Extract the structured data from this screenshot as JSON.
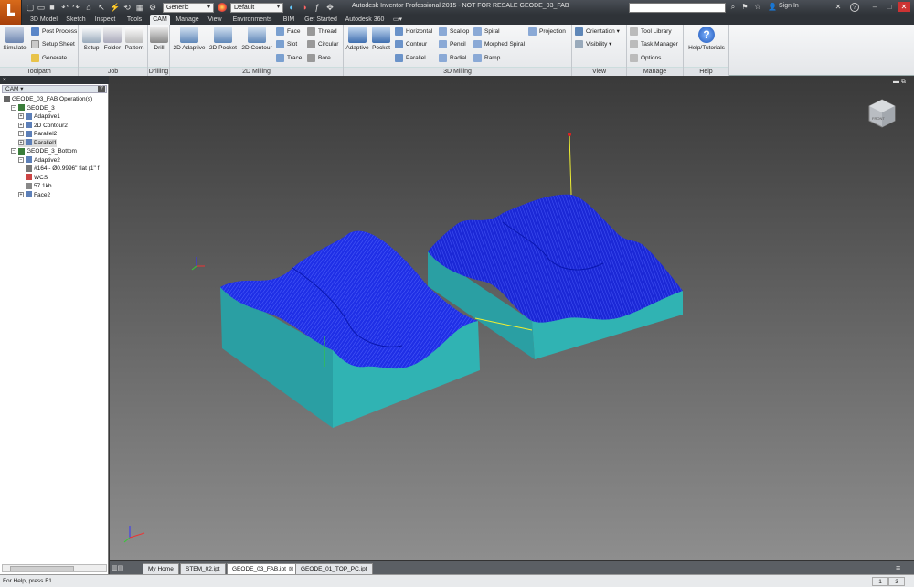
{
  "titlebar": {
    "app_title": "Autodesk Inventor Professional 2015 - NOT FOR RESALE   GEODE_03_FAB",
    "material_combo": "Generic",
    "appearance_combo": "Default",
    "search_placeholder": "",
    "sign_in": "Sign In",
    "help_label": "?"
  },
  "tabs": [
    "3D Model",
    "Sketch",
    "Inspect",
    "Tools",
    "CAM",
    "Manage",
    "View",
    "Environments",
    "BIM",
    "Get Started",
    "Autodesk 360"
  ],
  "active_tab": "CAM",
  "ribbon": {
    "toolpath": {
      "label": "Toolpath",
      "simulate": "Simulate",
      "post_process": "Post Process",
      "setup_sheet": "Setup Sheet",
      "generate": "Generate"
    },
    "job": {
      "label": "Job",
      "setup": "Setup",
      "folder": "Folder",
      "pattern": "Pattern"
    },
    "drilling": {
      "label": "Drilling",
      "drill": "Drill"
    },
    "milling2d": {
      "label": "2D Milling",
      "adaptive": "2D Adaptive",
      "pocket": "2D Pocket",
      "contour": "2D Contour",
      "face": "Face",
      "slot": "Slot",
      "trace": "Trace",
      "thread": "Thread",
      "circular": "Circular",
      "bore": "Bore"
    },
    "milling3d": {
      "label": "3D Milling",
      "adaptive": "Adaptive",
      "pocket": "Pocket",
      "horizontal": "Horizontal",
      "contour": "Contour",
      "parallel": "Parallel",
      "scallop": "Scallop",
      "pencil": "Pencil",
      "radial": "Radial",
      "spiral": "Spiral",
      "morphed_spiral": "Morphed Spiral",
      "ramp": "Ramp",
      "projection": "Projection"
    },
    "view": {
      "label": "View",
      "orientation": "Orientation",
      "visibility": "Visibility"
    },
    "manage": {
      "label": "Manage",
      "tool_library": "Tool Library",
      "task_manager": "Task Manager",
      "options": "Options"
    },
    "help": {
      "label": "Help",
      "help_tutorials": "Help/Tutorials"
    }
  },
  "browser": {
    "cam_label": "CAM ▾",
    "help_icon": "?",
    "tree": [
      {
        "label": "GEODE_03_FAB Operation(s)",
        "indent": 0,
        "expander": "",
        "icon": "gear",
        "selected": false
      },
      {
        "label": "GEODE_3",
        "indent": 1,
        "expander": "−",
        "icon": "setup",
        "selected": false
      },
      {
        "label": "Adaptive1",
        "indent": 2,
        "expander": "+",
        "icon": "op",
        "selected": false
      },
      {
        "label": "2D Contour2",
        "indent": 2,
        "expander": "+",
        "icon": "op",
        "selected": false
      },
      {
        "label": "Parallel2",
        "indent": 2,
        "expander": "+",
        "icon": "op",
        "selected": false
      },
      {
        "label": "Parallel1",
        "indent": 2,
        "expander": "+",
        "icon": "op",
        "selected": true
      },
      {
        "label": "GEODE_3_Bottom",
        "indent": 1,
        "expander": "−",
        "icon": "setup",
        "selected": false
      },
      {
        "label": "Adaptive2",
        "indent": 2,
        "expander": "−",
        "icon": "op",
        "selected": false
      },
      {
        "label": "#164 - Ø0.9996\" flat (1\" f",
        "indent": 3,
        "expander": "",
        "icon": "tool",
        "selected": false
      },
      {
        "label": "WCS",
        "indent": 3,
        "expander": "",
        "icon": "wcs",
        "selected": false
      },
      {
        "label": "57.1kb",
        "indent": 3,
        "expander": "",
        "icon": "file",
        "selected": false
      },
      {
        "label": "Face2",
        "indent": 2,
        "expander": "+",
        "icon": "op",
        "selected": false
      }
    ]
  },
  "viewcube_label": "FRONT",
  "doc_tabs": [
    {
      "label": "My Home",
      "active": false,
      "closable": false
    },
    {
      "label": "STEM_02.ipt",
      "active": false,
      "closable": false
    },
    {
      "label": "GEODE_03_FAB.ipt",
      "active": true,
      "closable": true
    },
    {
      "label": "GEODE_01_TOP_PC.ipt",
      "active": false,
      "closable": false
    }
  ],
  "status": {
    "text": "For Help, press F1",
    "count1": "1",
    "count2": "3"
  },
  "colors": {
    "ribbon_bg": "#eceef0",
    "toolpath_blue": "#1a2be0",
    "stock_teal": "#2aa7a7",
    "titlebar": "#3a3e44",
    "app_orange": "#d86a1a"
  }
}
